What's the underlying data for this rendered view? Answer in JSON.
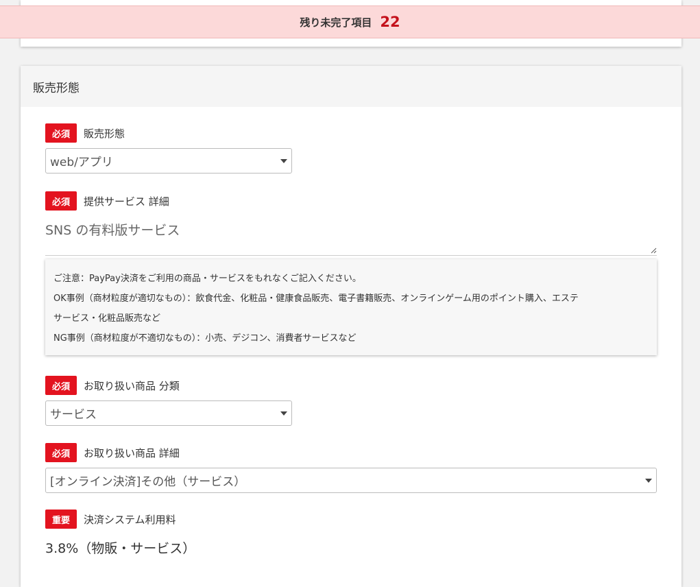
{
  "banner": {
    "label": "残り未完了項目",
    "count": "22"
  },
  "section": {
    "title": "販売形態",
    "fields": {
      "sales_form": {
        "badge": "必須",
        "label": "販売形態",
        "value": "web/アプリ"
      },
      "service_detail": {
        "badge": "必須",
        "label": "提供サービス 詳細",
        "value": "SNS の有料版サービス"
      },
      "product_category": {
        "badge": "必須",
        "label": "お取り扱い商品 分類",
        "value": "サービス"
      },
      "product_detail": {
        "badge": "必須",
        "label": "お取り扱い商品 詳細",
        "value": "[オンライン決済]その他（サービス）"
      },
      "fee": {
        "badge": "重要",
        "label": "決済システム利用料",
        "value": "3.8%（物販・サービス）"
      }
    },
    "notice": {
      "line1": "ご注意：PayPay決済をご利用の商品・サービスをもれなくご記入ください。",
      "line2": "OK事例（商材粒度が適切なもの）：飲食代金、化粧品・健康食品販売、電子書籍販売、オンラインゲーム用のポイント購入、エステ",
      "line3": "サービス・化粧品販売など",
      "line4": "NG事例（商材粒度が不適切なもの）：小売、デジコン、消費者サービスなど"
    }
  },
  "colors": {
    "badge": "#e3131f",
    "banner_bg": "#fcd9d9",
    "count": "#c4121c"
  }
}
